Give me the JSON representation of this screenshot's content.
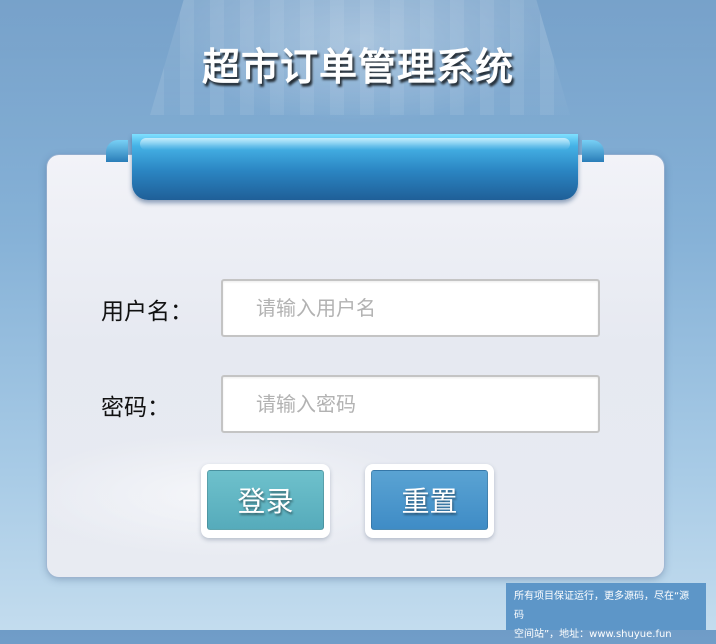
{
  "page": {
    "title": "超市订单管理系统"
  },
  "form": {
    "username_label": "用户名：",
    "username_placeholder": "请输入用户名",
    "username_value": "",
    "password_label": "密码：",
    "password_placeholder": "请输入密码",
    "password_value": ""
  },
  "buttons": {
    "login_label": "登录",
    "reset_label": "重置"
  },
  "watermark": {
    "line1": "所有项目保证运行，更多源码，尽在“源码",
    "line2": "空间站”，地址：www.shuyue.fun"
  },
  "colors": {
    "background_top": "#6f9cc7",
    "background_bottom": "#c3dcee",
    "ribbon": "#2b86c3",
    "login_button": "#5fb4c4",
    "reset_button": "#4a95cd",
    "watermark_bg": "#5d96c8"
  }
}
